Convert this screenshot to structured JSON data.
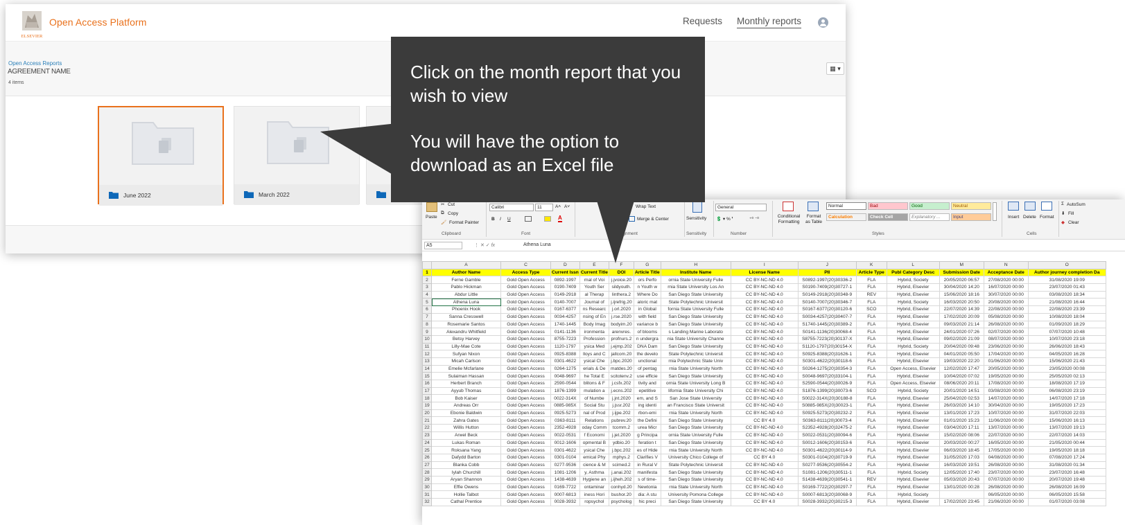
{
  "app": {
    "logo_text": "ELSEVIER",
    "title": "Open Access Platform",
    "nav": {
      "requests": "Requests",
      "monthly_reports": "Monthly reports"
    },
    "breadcrumb": "Open Access Reports",
    "agreement_name": "AGREEMENT NAME",
    "items_count": "4 items",
    "view_toggle": "▦ ▾",
    "folders": [
      {
        "label": "June 2022",
        "selected": true
      },
      {
        "label": "March 2022",
        "selected": false
      },
      {
        "label": "M",
        "selected": false
      }
    ]
  },
  "callout": {
    "line1": "Click on the month report that you wish to view",
    "line2": "You will have the option to download as an Excel file"
  },
  "excel": {
    "ribbon": {
      "clipboard": {
        "paste": "Paste",
        "cut": "Cut",
        "copy": "Copy",
        "format_painter": "Format Painter",
        "group": "Clipboard"
      },
      "font": {
        "name": "Calibri",
        "size": "11",
        "grow": "A˄",
        "shrink": "A˅",
        "bold": "B",
        "italic": "I",
        "underline": "U",
        "group": "Font"
      },
      "alignment": {
        "wrap_text": "Wrap Text",
        "merge_center": "Merge & Center",
        "group": "Alignment"
      },
      "sensitivity": {
        "label": "Sensitivity",
        "group": "Sensitivity"
      },
      "number": {
        "format": "General",
        "group": "Number"
      },
      "styles": {
        "conditional": "Conditional Formatting",
        "format_table": "Format as Table",
        "normal": "Normal",
        "bad": "Bad",
        "good": "Good",
        "neutral": "Neutral",
        "calculation": "Calculation",
        "check_cell": "Check Cell",
        "explanatory": "Explanatory ...",
        "input": "Input",
        "group": "Styles"
      },
      "cells": {
        "insert": "Insert",
        "delete": "Delete",
        "format": "Format",
        "group": "Cells"
      },
      "editing": {
        "autosum": "AutoSum",
        "fill": "Fill",
        "clear": "Clear"
      }
    },
    "name_box": "A5",
    "formula": "Athena Luna",
    "column_letters": [
      "A",
      "C",
      "D",
      "E",
      "F",
      "G",
      "H",
      "I",
      "J",
      "K",
      "L",
      "M",
      "N",
      "O"
    ],
    "headers": [
      "Author Name",
      "Access Type",
      "Current Issn",
      "Current Title",
      "DOI",
      "Article Title",
      "Institute Name",
      "License Name",
      "PII",
      "Article Type",
      "Publ Category Desc",
      "Submission Date",
      "Acceptance Date",
      "Author journey completion Da"
    ],
    "rows": [
      [
        "Ferne Gamble",
        "Gold Open Access",
        "0892-1997",
        "rnal of Voi",
        "j.jvoice.20",
        "ors Perfo",
        "ornia State University Fulle",
        "CC BY-NC-ND 4.0",
        "S0892-1997(20)30336-2",
        "FLA",
        "Hybrid, Society",
        "20/05/2020 06:57",
        "27/08/2020 00:00",
        "31/08/2020 19:09"
      ],
      [
        "Pablo Hickman",
        "Gold Open Access",
        "0190-7409",
        "Youth Ser",
        "sildyouth.",
        "n Youth w",
        "rnia State University Los An",
        "CC BY-NC-ND 4.0",
        "S0190-7409(20)30727-1",
        "FLA",
        "Hybrid, Elsevier",
        "30/04/2020 14:20",
        "16/07/2020 00:00",
        "23/07/2020 01:43"
      ],
      [
        "Abdur Little",
        "Gold Open Access",
        "0149-2918",
        "al Therap",
        "linthera.2",
        "Where Do",
        "San Diego State University",
        "CC BY-NC-ND 4.0",
        "S0149-2918(20)30348-9",
        "REV",
        "Hybrid, Elsevier",
        "15/06/2020 18:16",
        "30/07/2020 00:00",
        "03/08/2020 18:34"
      ],
      [
        "Athena Luna",
        "Gold Open Access",
        "0140-7007",
        "Journal of",
        "j.ijrefrig.20",
        "aloric mat",
        "State Polytechnic Universit",
        "CC BY-NC-ND 4.0",
        "S0140-7007(20)30346-7",
        "FLA",
        "Hybrid, Society",
        "16/03/2020 20:50",
        "20/08/2020 00:00",
        "21/08/2020 16:44"
      ],
      [
        "Phoenix Hook",
        "Gold Open Access",
        "0167-6377",
        "ns Researc",
        "j.orl.2020",
        "in Global",
        "fornia State University Fulle",
        "CC BY-NC-ND 4.0",
        "S0167-6377(20)30120-6",
        "SCO",
        "Hybrid, Elsevier",
        "22/07/2020 14:39",
        "22/08/2020 00:00",
        "22/08/2020 23:39"
      ],
      [
        "Sanna Cresswell",
        "Gold Open Access",
        "0034-4257",
        "nsing of En",
        "j.rse.2020",
        "with field",
        "San Diego State University",
        "CC BY-NC-ND 4.0",
        "S0034-4257(20)30407-7",
        "FLA",
        "Hybrid, Elsevier",
        "17/02/2020 20:09",
        "05/08/2020 00:00",
        "10/08/2020 18:04"
      ],
      [
        "Rosemarie Santos",
        "Gold Open Access",
        "1740-1445",
        "Body Imag",
        "bodyim.20",
        "variance b",
        "San Diego State University",
        "CC BY-NC-ND 4.0",
        "S1740-1445(20)30389-2",
        "FLA",
        "Hybrid, Elsevier",
        "09/03/2020 21:14",
        "26/08/2020 00:00",
        "01/09/2020 18:29"
      ],
      [
        "Alexandru Whitfield",
        "Gold Open Access",
        "0141-1136",
        "ironmenta",
        "arenvres.",
        "of blooms",
        "s Landing Marine Laborato",
        "CC BY-NC-ND 4.0",
        "S0141-1136(20)30068-4",
        "FLA",
        "Hybrid, Elsevier",
        "24/01/2020 07:26",
        "02/07/2020 00:00",
        "07/07/2020 10:48"
      ],
      [
        "Betsy Harvey",
        "Gold Open Access",
        "8755-7223",
        "Profession",
        "profnurs.2",
        "n undergra",
        "nia State University Channe",
        "CC BY-NC-ND 4.0",
        "S8755-7223(20)30137-X",
        "FLA",
        "Hybrid, Elsevier",
        "09/02/2020 21:09",
        "08/07/2020 00:00",
        "10/07/2020 23:18"
      ],
      [
        "Lilly-Mae Cote",
        "Gold Open Access",
        "1120-1797",
        "ysica Med",
        "j.ejmp.202",
        "DNA Dam",
        "San Diego State University",
        "CC BY-NC-ND 4.0",
        "S1120-1797(20)30154-X",
        "FLA",
        "Hybrid, Society",
        "20/04/2020 09:48",
        "23/06/2020 00:00",
        "26/06/2020 18:43"
      ],
      [
        "Sufyan Nixon",
        "Gold Open Access",
        "0925-8388",
        "lloys and C",
        "jallcom.20",
        "the develo",
        "State Polytechnic Universit",
        "CC BY-NC-ND 4.0",
        "S0925-8388(20)31626-1",
        "FLA",
        "Hybrid, Elsevier",
        "04/01/2020 05:50",
        "17/04/2020 00:00",
        "04/05/2020 16:28"
      ],
      [
        "Micah Carlson",
        "Gold Open Access",
        "0301-4622",
        "ysical Che",
        "j.bpc.2020",
        "unctional",
        "rnia Polytechnic State Univ",
        "CC BY-NC-ND 4.0",
        "S0301-4622(20)30118-6",
        "FLA",
        "Hybrid, Elsevier",
        "19/03/2020 22:20",
        "01/06/2020 00:00",
        "15/06/2020 21:43"
      ],
      [
        "Emelie Mcfarlane",
        "Gold Open Access",
        "0264-1275",
        "erials & De",
        "matdes.20",
        "of pentag",
        "rnia State University North",
        "CC BY-NC-ND 4.0",
        "S0264-1275(20)30354-3",
        "FLA",
        "Open Access, Elsevier",
        "12/02/2020 17:47",
        "20/05/2020 00:00",
        "23/05/2020 00:08"
      ],
      [
        "Sulaiman Hassan",
        "Gold Open Access",
        "0048-9697",
        "he Total E",
        "scitotenv.2",
        "use efficie",
        "San Diego State University",
        "CC BY-NC-ND 4.0",
        "S0048-9697(20)33104-1",
        "FLA",
        "Hybrid, Elsevier",
        "10/04/2020 07:02",
        "19/05/2020 00:00",
        "25/05/2020 02:13"
      ],
      [
        "Herbert Branch",
        "Gold Open Access",
        "2590-0544",
        "blitons & F",
        "j.csfx.202",
        "tivity and",
        "ornia State University Long B",
        "CC BY-NC-ND 4.0",
        "S2590-0544(20)30026-9",
        "FLA",
        "Open Access, Elsevier",
        "08/06/2020 20:11",
        "17/08/2020 00:00",
        "18/08/2020 17:19"
      ],
      [
        "Ayyub Thomas",
        "Gold Open Access",
        "1876-1399",
        "mulation a",
        "j.ecns.202",
        "epetitive",
        "lifornia State University Chi",
        "CC BY-NC-ND 4.0",
        "S1876-1399(20)30073-6",
        "SCO",
        "Hybrid, Society",
        "20/01/2020 14:51",
        "03/08/2020 00:00",
        "06/08/2020 23:19"
      ],
      [
        "Bob Kaiser",
        "Gold Open Access",
        "0022-314X",
        "of Numbe",
        "j.jnt.2020",
        "em, and S",
        "San Jose State University",
        "CC BY-NC-ND 4.0",
        "S0022-314X(20)30188-8",
        "FLA",
        "Hybrid, Elsevier",
        "25/04/2020 02:53",
        "14/07/2020 00:00",
        "14/07/2020 17:18"
      ],
      [
        "Andreas Orr",
        "Gold Open Access",
        "0885-985X",
        "Social Stu",
        "j.jssr.202",
        "ing identi",
        "an Francisco State Universit",
        "CC BY-NC-ND 4.0",
        "S0885-985X(20)30023-1",
        "FLA",
        "Hybrid, Elsevier",
        "26/03/2020 14:10",
        "30/04/2020 00:00",
        "19/05/2020 17:23"
      ],
      [
        "Ebonie Baldwin",
        "Gold Open Access",
        "0925-5273",
        "nal of Prod",
        "j.ijpe.202",
        "rbon-emi",
        "rnia State University North",
        "CC BY-NC-ND 4.0",
        "S0925-5273(20)30232-2",
        "FLA",
        "Hybrid, Elsevier",
        "13/01/2020 17:23",
        "10/07/2020 00:00",
        "31/07/2020 22:03"
      ],
      [
        "Zahra Gates",
        "Gold Open Access",
        "0363-8111",
        "Relations",
        "pubrev.20",
        "the Defini",
        "San Diego State University",
        "CC BY 4.0",
        "S0363-8111(20)30073-4",
        "FLA",
        "Hybrid, Elsevier",
        "01/01/2020 15:23",
        "11/06/2020 00:00",
        "15/06/2020 16:13"
      ],
      [
        "Willis Hutton",
        "Gold Open Access",
        "2352-4928",
        "oday Comm",
        "tcomm.2",
        "urea Micr",
        "San Diego State University",
        "CC BY-NC-ND 4.0",
        "S2352-4928(20)32475-2",
        "FLA",
        "Hybrid, Elsevier",
        "03/04/2020 17:11",
        "13/07/2020 00:00",
        "13/07/2020 19:13"
      ],
      [
        "Arwel Beck",
        "Gold Open Access",
        "0022-0531",
        "f Economi",
        "j.jet.2020",
        "g Principa",
        "ornia State University Fulle",
        "CC BY-NC-ND 4.0",
        "S0022-0531(20)30094-6",
        "FLA",
        "Hybrid, Elsevier",
        "15/02/2020 08:06",
        "22/07/2020 00:00",
        "22/07/2020 14:03"
      ],
      [
        "Lukas Roman",
        "Gold Open Access",
        "0012-1606",
        "opmental B",
        "ydbio.20",
        "feration t",
        "San Diego State University",
        "CC BY-NC-ND 4.0",
        "S0012-1606(20)30153-6",
        "FLA",
        "Hybrid, Elsevier",
        "20/03/2020 00:27",
        "16/05/2020 00:00",
        "21/05/2020 00:44"
      ],
      [
        "Roksana Yang",
        "Gold Open Access",
        "0301-4622",
        "ysical Che",
        "j.bpc.202",
        "es of Hide",
        "rnia State University North",
        "CC BY-NC-ND 4.0",
        "S0301-4622(20)30114-9",
        "FLA",
        "Hybrid, Elsevier",
        "06/03/2020 18:45",
        "17/05/2020 00:00",
        "19/05/2020 18:18"
      ],
      [
        "Dafydd Barton",
        "Gold Open Access",
        "0301-0104",
        "emical Phy",
        "mphys.2",
        "Clarifies V",
        "University Chico College of",
        "CC BY 4.0",
        "S0301-0104(20)30719-9",
        "FLA",
        "Hybrid, Elsevier",
        "31/05/2020 17:03",
        "04/08/2020 00:00",
        "07/08/2020 17:24"
      ],
      [
        "Blanka Cobb",
        "Gold Open Access",
        "0277-9536",
        "cience & M",
        "scimed.2",
        "in Rural V",
        "State Polytechnic Universit",
        "CC BY-NC-ND 4.0",
        "S0277-9536(20)30554-2",
        "FLA",
        "Hybrid, Elsevier",
        "16/03/2020 19:51",
        "26/08/2020 00:00",
        "31/08/2020 01:34"
      ],
      [
        "Iylah Churchill",
        "Gold Open Access",
        "1081-1206",
        "y, Asthma",
        "j.anai.202",
        "manifesta",
        "San Diego State University",
        "CC BY-NC-ND 4.0",
        "S1081-1206(20)30511-1",
        "FLA",
        "Hybrid, Society",
        "12/05/2020 17:40",
        "23/07/2020 00:00",
        "23/07/2020 16:48"
      ],
      [
        "Aryan Shannon",
        "Gold Open Access",
        "1438-4639",
        "Hygiene an",
        "j.ijheh.202",
        "s of time-",
        "San Diego State University",
        "CC BY-NC-ND 4.0",
        "S1438-4639(20)30541-1",
        "REV",
        "Hybrid, Elsevier",
        "05/03/2020 20:43",
        "07/07/2020 00:00",
        "20/07/2020 19:48"
      ],
      [
        "Effie Owens",
        "Gold Open Access",
        "0169-7722",
        "ontaminar",
        "conhyd.20",
        "Newtonia",
        "rnia State University North",
        "CC BY-NC-ND 4.0",
        "S0169-7722(20)30297-7",
        "FLA",
        "Hybrid, Elsevier",
        "13/01/2020 00:28",
        "26/08/2020 00:00",
        "26/08/2020 16:09"
      ],
      [
        "Hollie Talbot",
        "Gold Open Access",
        "0007-6813",
        "iness Hori",
        "bushor.20",
        "dia: A stu",
        "University Pomona College",
        "CC BY-NC-ND 4.0",
        "S0007-6813(20)30068-9",
        "FLA",
        "Hybrid, Society",
        "",
        "06/05/2020 00:00",
        "06/05/2020 15:58"
      ],
      [
        "Cathal Prentice",
        "Gold Open Access",
        "0028-3932",
        "ropsychol",
        "psycholog",
        "hic preci",
        "San Diego State University",
        "CC BY 4.0",
        "S0028-3932(20)30215-3",
        "FLA",
        "Hybrid, Elsevier",
        "17/02/2020 23:45",
        "21/06/2020 00:00",
        "01/07/2020 03:08"
      ]
    ]
  }
}
